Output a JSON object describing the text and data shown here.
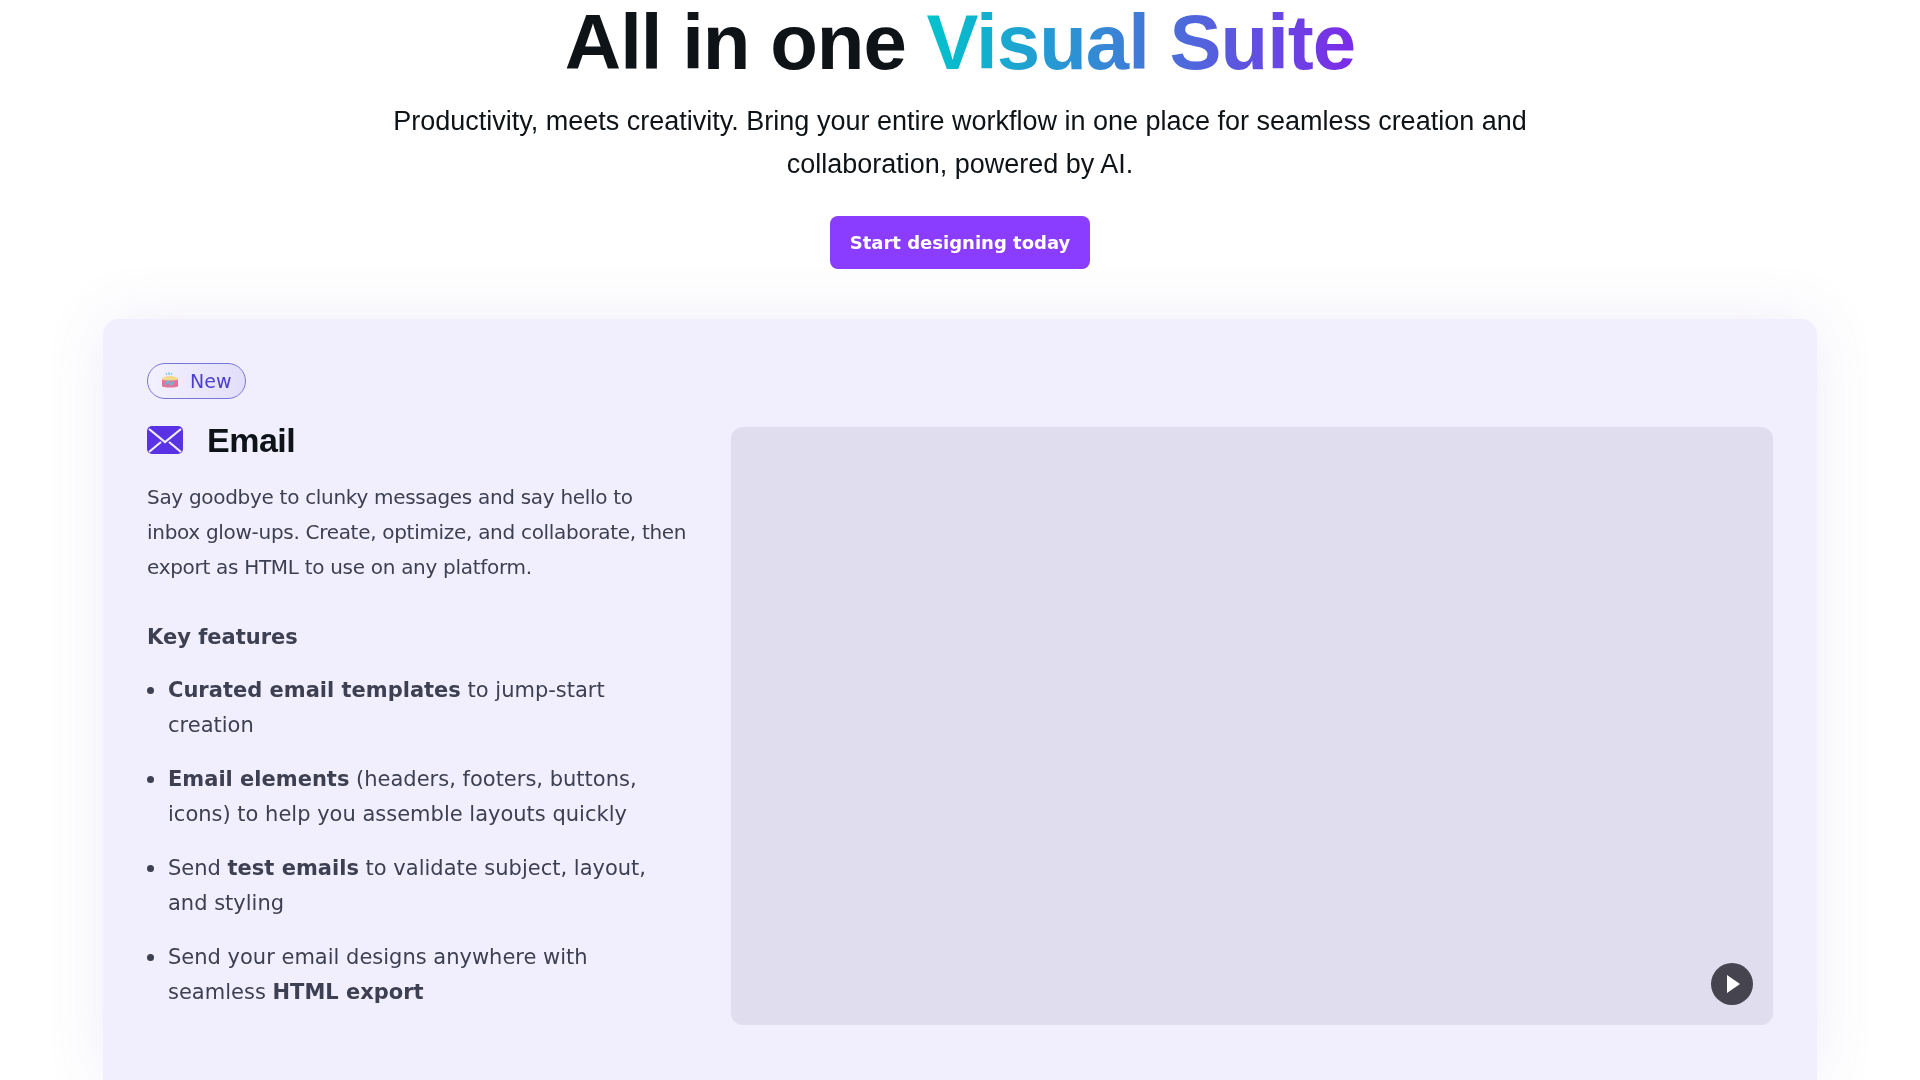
{
  "hero": {
    "title": "All in one",
    "title_highlight": "Visual Suite",
    "subtitle": "Productivity, meets creativity. Bring your entire workflow in one place for seamless creation and collaboration, powered by AI.",
    "cta": "Start designing today"
  },
  "feature": {
    "badge": "New",
    "title": "Email",
    "description": "Say goodbye to clunky messages and say hello to inbox glow-ups. Create, optimize, and collaborate, then export as HTML to use on any platform.",
    "features_heading": "Key features",
    "features": [
      "**Curated email templates** to jump-start creation",
      "**Email elements** (headers, footers, buttons, icons) to help you assemble layouts quickly",
      "Send **test emails** to validate subject, layout, and styling",
      "Send your email designs anywhere with seamless **HTML export**"
    ]
  }
}
